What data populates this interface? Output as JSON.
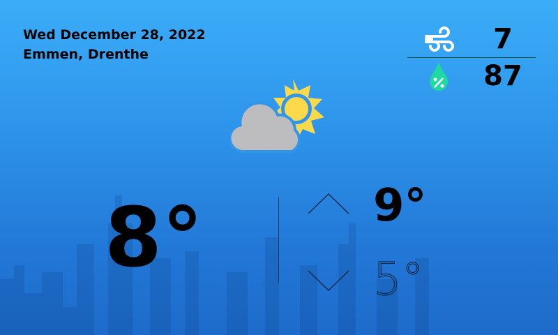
{
  "header": {
    "date": "Wed December 28, 2022",
    "location": "Emmen, Drenthe"
  },
  "stats": {
    "wind": {
      "icon": "wind-icon",
      "value": "7"
    },
    "humidity": {
      "icon": "humidity-drop-icon",
      "value": "87"
    }
  },
  "condition": {
    "icon": "partly-cloudy-icon"
  },
  "current": {
    "temperature": "8°"
  },
  "forecast": {
    "high": "9°",
    "low": "5°"
  },
  "colors": {
    "humidity": "#1ed9a0",
    "sun": "#fcd94a",
    "cloud": "#bdbdbf"
  }
}
